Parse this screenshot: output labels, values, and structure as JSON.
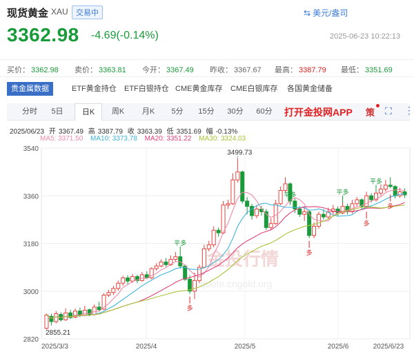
{
  "header": {
    "title": "现货黄金",
    "code": "XAU",
    "status_badge": "交易中",
    "currency_label": "美元/盎司",
    "price": "3362.98",
    "change": "-4.69(-0.14%)",
    "timestamp": "2025-06-23 10:22:13"
  },
  "stats": [
    {
      "label": "买价：",
      "value": "3362.98",
      "color": "#1a9a3a"
    },
    {
      "label": "卖价：",
      "value": "3363.81",
      "color": "#1a9a3a"
    },
    {
      "label": "今开：",
      "value": "3367.49",
      "color": "#1a9a3a"
    },
    {
      "label": "昨收：",
      "value": "3367.67",
      "color": "#333333"
    },
    {
      "label": "最高：",
      "value": "3387.79",
      "color": "#e02020"
    },
    {
      "label": "最低：",
      "value": "3351.69",
      "color": "#1a9a3a"
    }
  ],
  "tabs": [
    "贵金属数据",
    "ETF黄金持仓",
    "ETF白银持仓",
    "CME黄金库存",
    "CME白银库存",
    "各国黄金储备"
  ],
  "periods": [
    "分时",
    "5日",
    "日K",
    "周K",
    "月K",
    "5分",
    "15分",
    "30分",
    "60分"
  ],
  "active_period": "日K",
  "promo": "打开金投网APP",
  "toolbar": {
    "app_icon": "策",
    "fullscreen_icon": "⛶",
    "more_icon": "⋮"
  },
  "ohlc": {
    "date": "2025/06/23",
    "open_label": "开",
    "open": "3367.49",
    "high_label": "高",
    "high": "3387.79",
    "close_label": "收",
    "close": "3363.39",
    "low_label": "低",
    "low": "3351.69",
    "amp_label": "幅",
    "amp": "-0.13%"
  },
  "ma_legend": [
    {
      "text": "MA5: 3371.50",
      "color": "#f08aa8"
    },
    {
      "text": "MA10: 3373.78",
      "color": "#3fb5d9"
    },
    {
      "text": "MA20: 3351.22",
      "color": "#e0407a"
    },
    {
      "text": "MA30: 3324.03",
      "color": "#a8c43a"
    }
  ],
  "watermark": [
    "金投行情",
    "quote.cngold.org"
  ],
  "chart_data": {
    "type": "candlestick",
    "y_ticks": [
      3540,
      3360,
      3180,
      3000,
      2820
    ],
    "ylim": [
      2820,
      3540
    ],
    "x_ticks": [
      "2025/3/3",
      "2025/4",
      "2025/5",
      "2025/6",
      "2025/6/23"
    ],
    "annotations": {
      "max": "3499.73",
      "min": "2855.21",
      "flat": "平多",
      "flat2": "平多",
      "flat3": "平多",
      "flat4": "平多",
      "long": "多",
      "long2": "多",
      "long3": "多",
      "long4": "多"
    },
    "candles": [
      [
        2860,
        2910,
        2915,
        2855.21
      ],
      [
        2905,
        2885,
        2915,
        2870
      ],
      [
        2885,
        2915,
        2925,
        2878
      ],
      [
        2912,
        2892,
        2920,
        2885
      ],
      [
        2892,
        2918,
        2935,
        2888
      ],
      [
        2918,
        2900,
        2930,
        2895
      ],
      [
        2902,
        2925,
        2935,
        2898
      ],
      [
        2925,
        2910,
        2938,
        2902
      ],
      [
        2910,
        2928,
        2945,
        2905
      ],
      [
        2930,
        2912,
        2935,
        2905
      ],
      [
        2912,
        2940,
        2950,
        2908
      ],
      [
        2940,
        2930,
        2960,
        2925
      ],
      [
        2932,
        2985,
        2992,
        2928
      ],
      [
        2985,
        2995,
        3005,
        2978
      ],
      [
        2995,
        3010,
        3020,
        2985
      ],
      [
        3010,
        3030,
        3040,
        3002
      ],
      [
        3030,
        3050,
        3058,
        3020
      ],
      [
        3050,
        3038,
        3060,
        3025
      ],
      [
        3038,
        3055,
        3065,
        3030
      ],
      [
        3055,
        3040,
        3062,
        3030
      ],
      [
        3040,
        3062,
        3072,
        3036
      ],
      [
        3062,
        3050,
        3075,
        3045
      ],
      [
        3050,
        3085,
        3090,
        3045
      ],
      [
        3085,
        3095,
        3105,
        3078
      ],
      [
        3095,
        3110,
        3120,
        3090
      ],
      [
        3110,
        3100,
        3125,
        3092
      ],
      [
        3100,
        3120,
        3135,
        3095
      ],
      [
        3120,
        3130,
        3148,
        3112
      ],
      [
        3130,
        3095,
        3145,
        3085
      ],
      [
        3095,
        3045,
        3100,
        3038
      ],
      [
        3045,
        3000,
        3060,
        2990
      ],
      [
        3000,
        3040,
        3070,
        2970
      ],
      [
        3040,
        3090,
        3100,
        3030
      ],
      [
        3090,
        3160,
        3175,
        3085
      ],
      [
        3160,
        3175,
        3190,
        3150
      ],
      [
        3175,
        3230,
        3245,
        3165
      ],
      [
        3230,
        3220,
        3240,
        3205
      ],
      [
        3220,
        3325,
        3340,
        3215
      ],
      [
        3325,
        3330,
        3345,
        3310
      ],
      [
        3330,
        3420,
        3445,
        3325
      ],
      [
        3420,
        3450,
        3499.73,
        3410
      ],
      [
        3450,
        3340,
        3455,
        3330
      ],
      [
        3340,
        3320,
        3355,
        3290
      ],
      [
        3320,
        3285,
        3330,
        3270
      ],
      [
        3285,
        3310,
        3325,
        3275
      ],
      [
        3310,
        3300,
        3322,
        3285
      ],
      [
        3300,
        3240,
        3310,
        3230
      ],
      [
        3240,
        3255,
        3275,
        3230
      ],
      [
        3255,
        3330,
        3345,
        3250
      ],
      [
        3330,
        3380,
        3395,
        3325
      ],
      [
        3380,
        3405,
        3430,
        3370
      ],
      [
        3405,
        3340,
        3410,
        3330
      ],
      [
        3340,
        3310,
        3350,
        3295
      ],
      [
        3310,
        3290,
        3320,
        3280
      ],
      [
        3290,
        3300,
        3320,
        3265
      ],
      [
        3300,
        3210,
        3305,
        3200
      ],
      [
        3210,
        3245,
        3260,
        3200
      ],
      [
        3245,
        3290,
        3300,
        3235
      ],
      [
        3290,
        3280,
        3310,
        3270
      ],
      [
        3280,
        3300,
        3315,
        3270
      ],
      [
        3300,
        3310,
        3325,
        3290
      ],
      [
        3310,
        3295,
        3320,
        3285
      ],
      [
        3295,
        3320,
        3340,
        3290
      ],
      [
        3320,
        3300,
        3330,
        3290
      ],
      [
        3300,
        3330,
        3345,
        3292
      ],
      [
        3330,
        3345,
        3355,
        3320
      ],
      [
        3345,
        3320,
        3350,
        3310
      ],
      [
        3320,
        3360,
        3375,
        3315
      ],
      [
        3360,
        3345,
        3370,
        3335
      ],
      [
        3345,
        3370,
        3380,
        3338
      ],
      [
        3370,
        3385,
        3403,
        3360
      ],
      [
        3385,
        3400,
        3420,
        3375
      ],
      [
        3400,
        3395,
        3430,
        3388
      ],
      [
        3395,
        3360,
        3400,
        3350
      ],
      [
        3360,
        3375,
        3390,
        3352
      ],
      [
        3375,
        3363.39,
        3387.79,
        3351.69
      ]
    ]
  }
}
